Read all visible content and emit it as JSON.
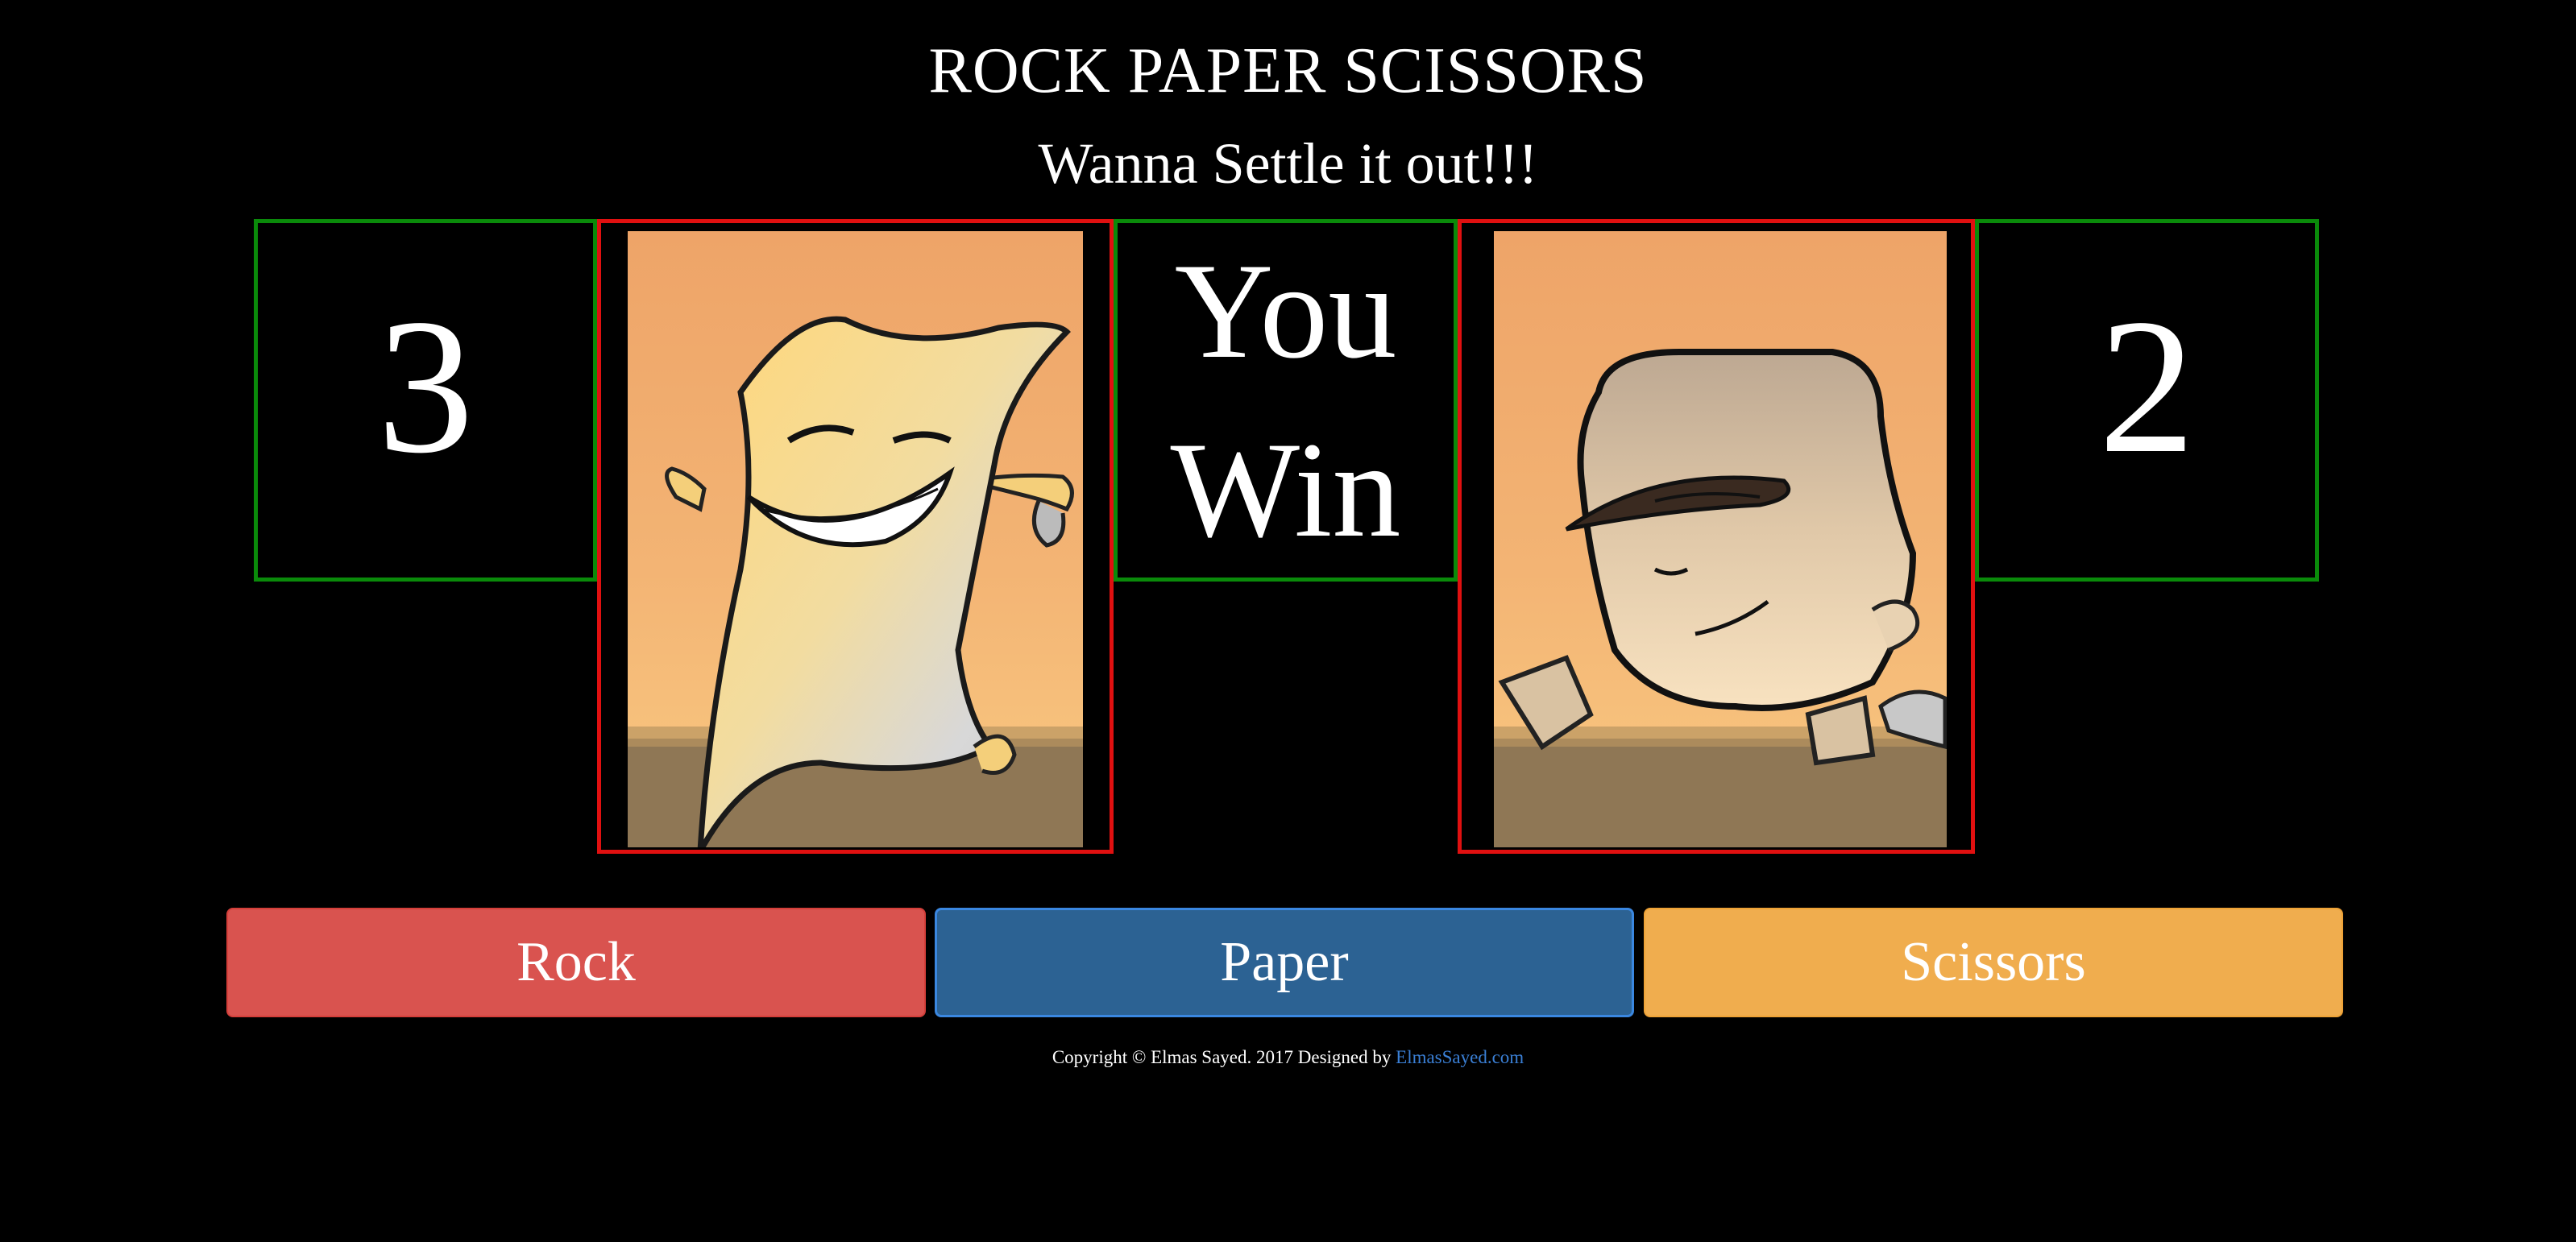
{
  "header": {
    "title": "ROCK PAPER SCISSORS",
    "subtitle": "Wanna Settle it out!!!"
  },
  "scoreboard": {
    "player_score": "3",
    "computer_score": "2",
    "result_line1": "You",
    "result_line2": "Win"
  },
  "cards": {
    "player_choice": "paper",
    "computer_choice": "rock"
  },
  "buttons": {
    "rock": "Rock",
    "paper": "Paper",
    "scissors": "Scissors"
  },
  "footer": {
    "text": "Copyright © Elmas Sayed. 2017 Designed by",
    "link_text": "ElmasSayed.com"
  },
  "colors": {
    "score_border": "#0a8a0a",
    "card_border": "#e01010",
    "rock_button": "#d9534f",
    "paper_button": "#2c6293",
    "scissors_button": "#f0ad4e",
    "link": "#3a7fd5"
  }
}
